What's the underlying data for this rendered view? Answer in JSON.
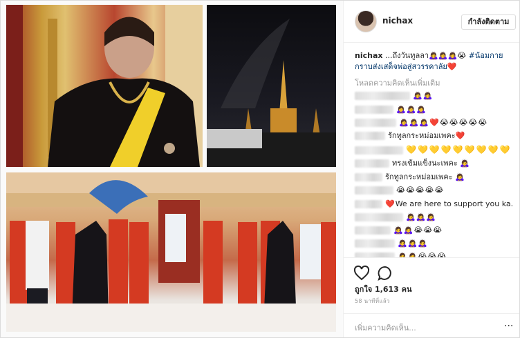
{
  "post": {
    "username": "nichax",
    "follow_label": "กำลังติดตาม",
    "caption_user": "nichax",
    "caption_text": " ...ถึงวันทูลลา",
    "caption_emoji": "🙇‍♀️🙇‍♀️🙇‍♀️😭",
    "caption_tags": "#น้อมกายกราบส่งเสด็จพ่อสู่สวรรคาลัย",
    "caption_heart": "❤️",
    "load_more": "โหลดความคิดเห็นเพิ่มเติม",
    "likes_label": "ถูกใจ",
    "likes_count": "1,613",
    "likes_unit": "คน",
    "time": "58 นาทีที่แล้ว",
    "add_comment_placeholder": "เพิ่มความคิดเห็น..."
  },
  "comments": [
    {
      "text": "",
      "emoji": "🙇‍♀️🙇‍♀️"
    },
    {
      "text": "",
      "emoji": "🙇‍♀️🙇‍♀️🙇‍♀️"
    },
    {
      "text": "",
      "emoji": "🙇‍♀️🙇‍♀️🙇‍♀️❤️😭😭😭😭😭"
    },
    {
      "text": "รักทูลกระหม่อมเพคะ",
      "emoji": "❤️"
    },
    {
      "text": "",
      "emoji": "💛💛💛💛💛💛💛💛💛"
    },
    {
      "text": "ทรงเข้มแข็งนะเพคะ",
      "emoji": "🙇‍♀️"
    },
    {
      "text": "รักทูลกระหม่อมเพคะ",
      "emoji": "🙇‍♀️"
    },
    {
      "text": "",
      "emoji": "😭😭😭😭😭"
    },
    {
      "text": "We are here to support you ka.",
      "emoji": "❤️"
    },
    {
      "text": "",
      "emoji": "🙇‍♀️🙇‍♀️🙇‍♀️"
    },
    {
      "text": "",
      "emoji": "🙇‍♀️🙇‍♀️😭😭😭"
    },
    {
      "text": "",
      "emoji": "🙇‍♀️🙇‍♀️🙇‍♀️"
    },
    {
      "text": "",
      "emoji": "🙇‍♀️🙇‍♀️😭😭😭"
    }
  ],
  "icons": {
    "like": "heart-outline-icon",
    "comment": "speech-bubble-icon",
    "more": "ellipsis-icon"
  }
}
